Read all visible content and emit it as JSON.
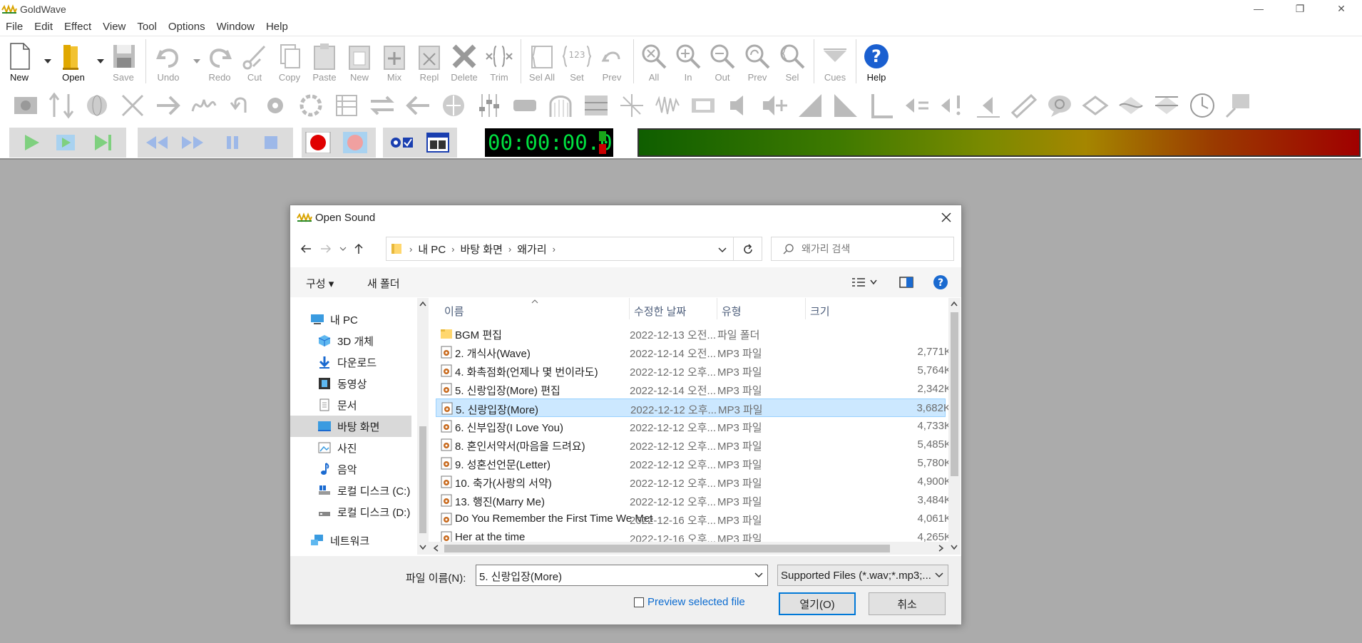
{
  "app": {
    "title": "GoldWave"
  },
  "window_controls": {
    "minimize": "—",
    "restore": "❐",
    "close": "✕"
  },
  "menu": [
    "File",
    "Edit",
    "Effect",
    "View",
    "Tool",
    "Options",
    "Window",
    "Help"
  ],
  "toolbar": {
    "new": "New",
    "open": "Open",
    "save": "Save",
    "undo": "Undo",
    "redo": "Redo",
    "cut": "Cut",
    "copy": "Copy",
    "paste": "Paste",
    "paste_new": "New",
    "mix": "Mix",
    "replace": "Repl",
    "delete": "Delete",
    "trim": "Trim",
    "sel_all": "Sel All",
    "set": "Set",
    "prev": "Prev",
    "zoom_all": "All",
    "zoom_in": "In",
    "zoom_out": "Out",
    "zoom_prev": "Prev",
    "zoom_sel": "Sel",
    "cues": "Cues",
    "help": "Help"
  },
  "transport": {
    "timer": "00:00:00.0"
  },
  "dialog": {
    "title": "Open Sound",
    "address": [
      "내 PC",
      "바탕 화면",
      "왜가리"
    ],
    "search_placeholder": "왜가리 검색",
    "organize": "구성",
    "new_folder": "새 폴더",
    "nav_items": [
      {
        "label": "내 PC"
      },
      {
        "label": "3D 개체"
      },
      {
        "label": "다운로드"
      },
      {
        "label": "동영상"
      },
      {
        "label": "문서"
      },
      {
        "label": "바탕 화면"
      },
      {
        "label": "사진"
      },
      {
        "label": "음악"
      },
      {
        "label": "로컬 디스크 (C:)"
      },
      {
        "label": "로컬 디스크 (D:)"
      },
      {
        "label": "네트워크"
      }
    ],
    "columns": {
      "name": "이름",
      "date": "수정한 날짜",
      "type": "유형",
      "size": "크기"
    },
    "files": [
      {
        "name": "BGM 편집",
        "date": "2022-12-13 오전...",
        "type": "파일 폴더",
        "size": ""
      },
      {
        "name": "2. 개식사(Wave)",
        "date": "2022-12-14 오전...",
        "type": "MP3 파일",
        "size": "2,771K"
      },
      {
        "name": "4. 화촉점화(언제나 몇 번이라도)",
        "date": "2022-12-12 오후...",
        "type": "MP3 파일",
        "size": "5,764K"
      },
      {
        "name": "5. 신랑입장(More) 편집",
        "date": "2022-12-14 오전...",
        "type": "MP3 파일",
        "size": "2,342K"
      },
      {
        "name": "5. 신랑입장(More)",
        "date": "2022-12-12 오후...",
        "type": "MP3 파일",
        "size": "3,682K"
      },
      {
        "name": "6. 신부입장(I Love You)",
        "date": "2022-12-12 오후...",
        "type": "MP3 파일",
        "size": "4,733K"
      },
      {
        "name": "8. 혼인서약서(마음을 드려요)",
        "date": "2022-12-12 오후...",
        "type": "MP3 파일",
        "size": "5,485K"
      },
      {
        "name": "9. 성혼선언문(Letter)",
        "date": "2022-12-12 오후...",
        "type": "MP3 파일",
        "size": "5,780K"
      },
      {
        "name": "10. 축가(사랑의 서약)",
        "date": "2022-12-12 오후...",
        "type": "MP3 파일",
        "size": "4,900K"
      },
      {
        "name": "13. 행진(Marry Me)",
        "date": "2022-12-12 오후...",
        "type": "MP3 파일",
        "size": "3,484K"
      },
      {
        "name": "Do You Remember the First Time We Met",
        "date": "2022-12-16 오후...",
        "type": "MP3 파일",
        "size": "4,061K"
      },
      {
        "name": "Her at the time",
        "date": "2022-12-16 오후...",
        "type": "MP3 파일",
        "size": "4,265K"
      }
    ],
    "filename_label": "파일 이름(N):",
    "filename_value": "5. 신랑입장(More)",
    "filetype_value": "Supported Files (*.wav;*.mp3;...",
    "preview_label": "Preview selected file",
    "open_button": "열기(O)",
    "cancel_button": "취소"
  },
  "colors": {
    "accent": "#0078d7",
    "selection": "#cce8ff",
    "timer_text": "#00e040"
  }
}
